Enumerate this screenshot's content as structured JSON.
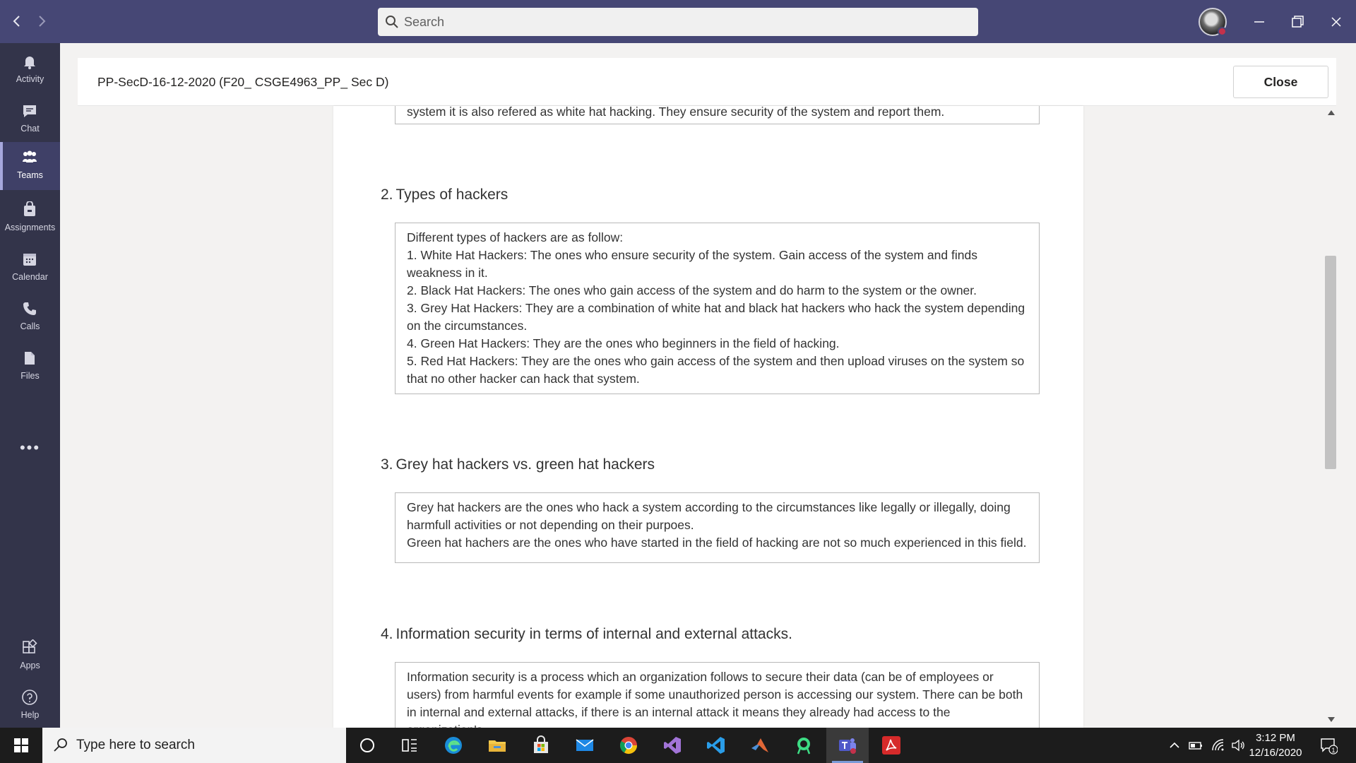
{
  "search": {
    "placeholder": "Search"
  },
  "rail": {
    "items": [
      {
        "label": "Activity",
        "icon": "bell-icon"
      },
      {
        "label": "Chat",
        "icon": "chat-icon"
      },
      {
        "label": "Teams",
        "icon": "teams-icon",
        "active": true
      },
      {
        "label": "Assignments",
        "icon": "assignments-icon"
      },
      {
        "label": "Calendar",
        "icon": "calendar-icon"
      },
      {
        "label": "Calls",
        "icon": "phone-icon"
      },
      {
        "label": "Files",
        "icon": "file-icon"
      }
    ],
    "more": "•••",
    "bottom": [
      {
        "label": "Apps",
        "icon": "apps-icon"
      },
      {
        "label": "Help",
        "icon": "help-icon"
      }
    ]
  },
  "header": {
    "title": "PP-SecD-16-12-2020 (F20_ CSGE4963_PP_ Sec D)",
    "close_label": "Close"
  },
  "questions": [
    {
      "partial_answer": "system it is also refered as white hat hacking. They ensure security of the system and report them."
    },
    {
      "number": "2.",
      "title": "Types of hackers",
      "answer_lines": [
        "Different types of hackers are as follow:",
        "1. White Hat Hackers: The ones who ensure security of the system. Gain access of the system and finds weakness in it.",
        "2. Black Hat Hackers: The ones who gain access of the system and do harm to the system or the owner.",
        "3. Grey Hat Hackers: They are a combination of white hat and black hat hackers who hack the system depending on the circumstances.",
        "4. Green Hat Hackers: They are the ones who beginners in the field of hacking.",
        "5. Red Hat Hackers: They are the ones who gain access of the system and then upload viruses on the system so that no other hacker can hack that system."
      ]
    },
    {
      "number": "3.",
      "title": "Grey hat hackers vs. green hat hackers",
      "answer_lines": [
        "Grey hat hackers are the ones who hack a system according to the circumstances like legally or illegally, doing harmfull activities or not depending on their purpoes.",
        "Green hat hachers are the ones who have started in the field of hacking are not so much experienced in this field."
      ]
    },
    {
      "number": "4.",
      "title": "Information security in terms of internal and external attacks.",
      "answer_lines": [
        "Information security is a process which an organization follows to secure their data (can be of employees or users) from harmful events for example if some unauthorized person is accessing our system. There can be both in internal and external attacks, if there is an internal attack it means they already had access to the organization's"
      ]
    }
  ],
  "taskbar": {
    "search_placeholder": "Type here to search",
    "time": "3:12 PM",
    "date": "12/16/2020",
    "notification_count": "1"
  },
  "colors": {
    "titlebar": "#464775",
    "rail": "#33344a",
    "accent": "#a6a7dc"
  }
}
